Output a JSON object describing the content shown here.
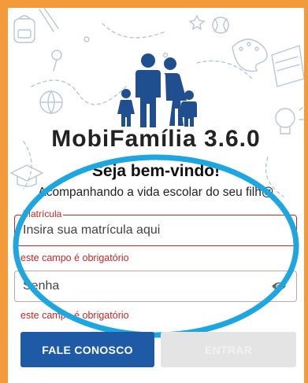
{
  "app": {
    "title": "MobiFamília 3.6.0",
    "welcome": "Seja bem-vindo!",
    "subtitle": "Acompanhando a vida escolar do seu filh@"
  },
  "form": {
    "registration": {
      "label": "Matrícula",
      "placeholder": "Insira sua matrícula aqui",
      "error": "este campo é obrigatório"
    },
    "password": {
      "placeholder": "Senha",
      "error": "este campo é obrigatório"
    }
  },
  "buttons": {
    "contact": "FALE CONOSCO",
    "enter": "ENTRAR"
  },
  "icons": {
    "logo": "family-logo-icon",
    "password_toggle": "eye-icon"
  },
  "colors": {
    "frame": "#f39a3a",
    "primary": "#1f5aa6",
    "error": "#c62828",
    "annotation": "#1ea6e0"
  }
}
